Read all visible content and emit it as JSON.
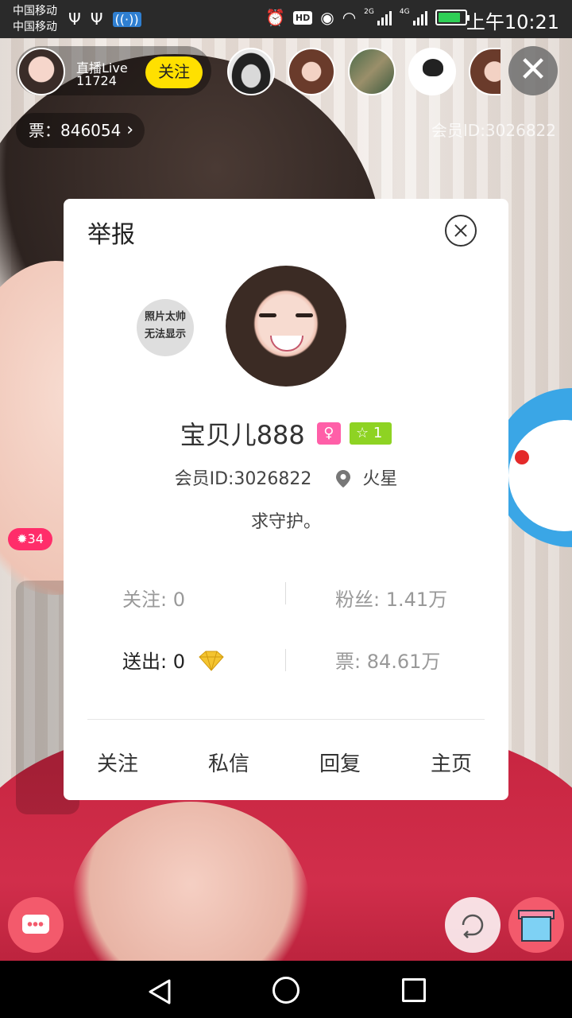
{
  "status_bar": {
    "carrier_1": "中国移动",
    "carrier_2": "中国移动",
    "network_1": "2G",
    "network_2": "4G",
    "time": "上午10:21",
    "hd_label": "HD",
    "battery_level": 0.8,
    "icons": [
      "usb-icon",
      "usb-icon",
      "hotspot-icon",
      "alarm-icon",
      "eye-icon",
      "wifi-icon",
      "signal-icon",
      "battery-icon"
    ]
  },
  "live": {
    "host_label": "直播Live",
    "viewer_count": "11724",
    "follow_label": "关注",
    "tickets": "票：846054",
    "member_id": "会员ID:3026822",
    "level_badge": "34"
  },
  "profile_card": {
    "title": "举报",
    "placeholder_text_1": "照片太帅",
    "placeholder_text_2": "无法显示",
    "nickname": "宝贝儿888",
    "level": "1",
    "member_id": "会员ID:3026822",
    "location": "火星",
    "signature": "求守护。",
    "stats": {
      "following": "关注: 0",
      "fans": "粉丝: 1.41万",
      "sent": "送出: 0",
      "tickets": "票: 84.61万"
    },
    "actions": [
      "关注",
      "私信",
      "回复",
      "主页"
    ]
  },
  "colors": {
    "follow_yellow": "#ffe000",
    "accent_pink": "#f35a6c",
    "level_green": "#8ed323",
    "gender_pink": "#ff5fa8"
  }
}
